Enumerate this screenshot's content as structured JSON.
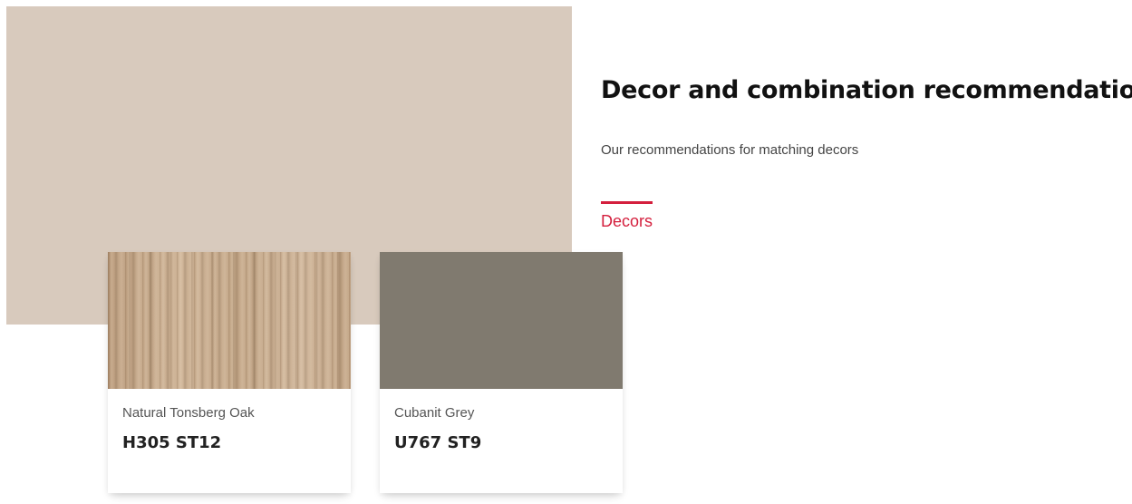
{
  "hero": {
    "color": "#d8cabd"
  },
  "section": {
    "title": "Decor and combination recommendations",
    "subtitle": "Our recommendations for matching decors"
  },
  "tabs": [
    {
      "label": "Decors",
      "active": true,
      "accent_color": "#d41f3d"
    }
  ],
  "cards": [
    {
      "name": "Natural Tonsberg Oak",
      "code": "H305 ST12",
      "swatch": "wood-texture",
      "color": "#c6a98a"
    },
    {
      "name": "Cubanit Grey",
      "code": "U767 ST9",
      "swatch": "solid",
      "color": "#807a6f"
    }
  ]
}
